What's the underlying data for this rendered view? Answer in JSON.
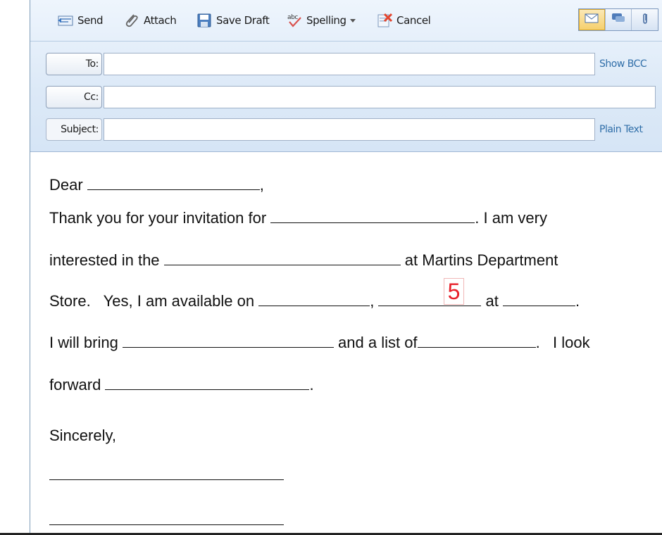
{
  "toolbar": {
    "send_label": "Send",
    "attach_label": "Attach",
    "save_draft_label": "Save Draft",
    "spelling_label": "Spelling",
    "cancel_label": "Cancel",
    "icons": {
      "send": "send-icon",
      "attach": "paperclip-icon",
      "save_draft": "floppy-disk-icon",
      "spelling": "spellcheck-icon",
      "cancel": "cancel-icon"
    },
    "view_buttons": [
      "envelope-icon",
      "speech-bubble-icon",
      "paperclip-icon"
    ]
  },
  "fields": {
    "to": {
      "label": "To:",
      "value": "",
      "link": "Show BCC"
    },
    "cc": {
      "label": "Cc:",
      "value": ""
    },
    "subject": {
      "label": "Subject:",
      "value": "",
      "link": "Plain Text"
    }
  },
  "letter": {
    "line1_a": "Dear ",
    "line1_b": ",",
    "line2_a": "Thank you for your invitation for ",
    "line2_b": ". I am very",
    "line3_a": "interested in the ",
    "line3_b": " at Martins Department",
    "line4_a": "Store.   Yes, I am available on ",
    "line4_b": ", ",
    "line4_c": " at ",
    "line4_d": ".",
    "line5_a": "I will bring ",
    "line5_b": " and a list of",
    "line5_c": ".   I look",
    "line6_a": "forward ",
    "line6_b": ".",
    "closing": "Sincerely,"
  },
  "marker": {
    "number": "5",
    "color": "#e8202a"
  },
  "colors": {
    "toolbar_bg": "#dce9f7",
    "link": "#2f6ea8"
  }
}
